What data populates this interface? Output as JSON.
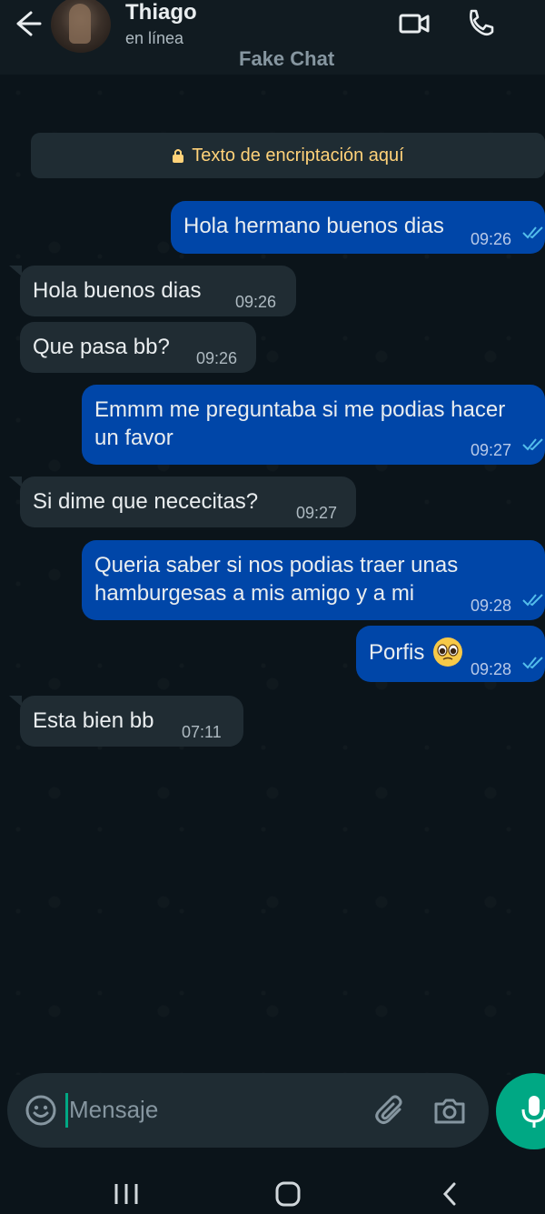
{
  "header": {
    "name": "Thiago",
    "status": "en línea",
    "subtitle": "Fake Chat"
  },
  "encryption": {
    "text": "Texto de encriptación aquí"
  },
  "messages": [
    {
      "dir": "out",
      "text": "Hola hermano buenos dias",
      "time": "09:26"
    },
    {
      "dir": "in",
      "text": "Hola buenos dias",
      "time": "09:26"
    },
    {
      "dir": "in",
      "text": "Que pasa bb?",
      "time": "09:26"
    },
    {
      "dir": "out",
      "text_line1": "Emmm me preguntaba si me podias hacer",
      "text_line2": "un favor",
      "time": "09:27"
    },
    {
      "dir": "in",
      "text": "Si dime que nececitas?",
      "time": "09:27"
    },
    {
      "dir": "out",
      "text_line1": "Queria saber si nos podias traer unas",
      "text_line2": "hamburgesas a mis amigo y a mi",
      "time": "09:28"
    },
    {
      "dir": "out",
      "text": "Porfis",
      "emoji": "pleading-face",
      "time": "09:28"
    },
    {
      "dir": "in",
      "text": "Esta bien bb",
      "time": "07:11"
    }
  ],
  "composer": {
    "placeholder": "Mensaje"
  },
  "colors": {
    "background": "#0b141a",
    "incoming": "#202c33",
    "outgoing": "#0046a8",
    "accent": "#00a884",
    "encryption_text": "#ffd279"
  },
  "icons": [
    "back-arrow-icon",
    "video-icon",
    "phone-icon",
    "more-vert-icon",
    "lock-icon",
    "read-ticks-icon",
    "emoji-icon",
    "attach-icon",
    "camera-icon",
    "mic-icon",
    "nav-recent-icon",
    "nav-home-icon",
    "nav-back-icon"
  ]
}
